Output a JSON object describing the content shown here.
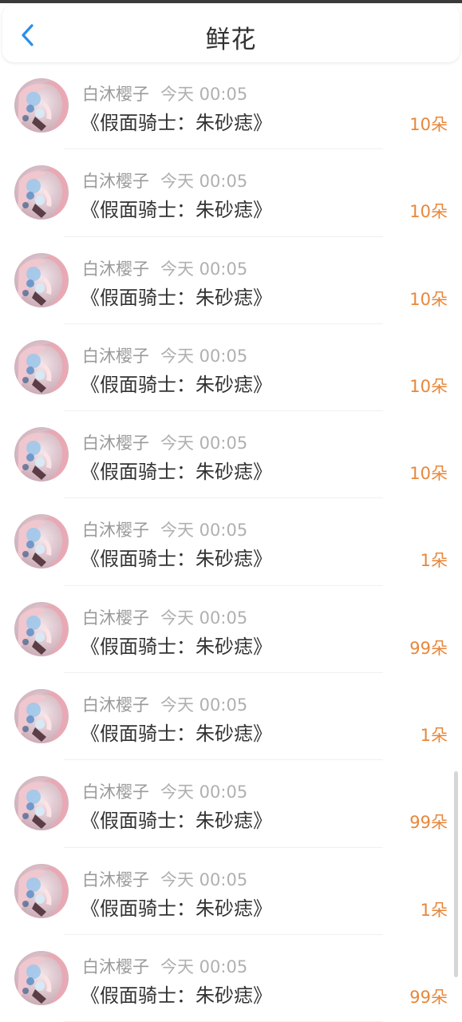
{
  "header": {
    "title": "鲜花",
    "back_icon": "chevron-left-icon",
    "accent": "#2a8fe8"
  },
  "colors": {
    "count": "#e8873a",
    "name": "#9a9a9a",
    "title": "#333333"
  },
  "items": [
    {
      "user": "白沐樱子",
      "time": "今天 00:05",
      "title": "《假面骑士：朱砂痣》",
      "count": "10朵"
    },
    {
      "user": "白沐樱子",
      "time": "今天 00:05",
      "title": "《假面骑士：朱砂痣》",
      "count": "10朵"
    },
    {
      "user": "白沐樱子",
      "time": "今天 00:05",
      "title": "《假面骑士：朱砂痣》",
      "count": "10朵"
    },
    {
      "user": "白沐樱子",
      "time": "今天 00:05",
      "title": "《假面骑士：朱砂痣》",
      "count": "10朵"
    },
    {
      "user": "白沐樱子",
      "time": "今天 00:05",
      "title": "《假面骑士：朱砂痣》",
      "count": "10朵"
    },
    {
      "user": "白沐樱子",
      "time": "今天 00:05",
      "title": "《假面骑士：朱砂痣》",
      "count": "1朵"
    },
    {
      "user": "白沐樱子",
      "time": "今天 00:05",
      "title": "《假面骑士：朱砂痣》",
      "count": "99朵"
    },
    {
      "user": "白沐樱子",
      "time": "今天 00:05",
      "title": "《假面骑士：朱砂痣》",
      "count": "1朵"
    },
    {
      "user": "白沐樱子",
      "time": "今天 00:05",
      "title": "《假面骑士：朱砂痣》",
      "count": "99朵"
    },
    {
      "user": "白沐樱子",
      "time": "今天 00:05",
      "title": "《假面骑士：朱砂痣》",
      "count": "1朵"
    },
    {
      "user": "白沐樱子",
      "time": "今天 00:05",
      "title": "《假面骑士：朱砂痣》",
      "count": "99朵"
    }
  ]
}
